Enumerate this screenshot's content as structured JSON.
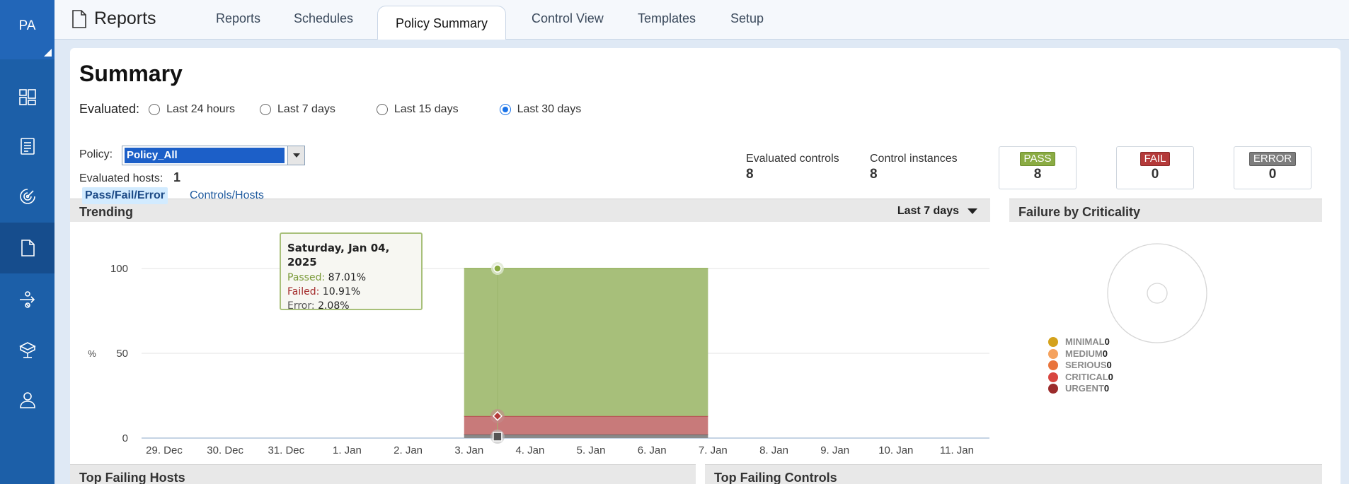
{
  "brand": "PA",
  "app_title": "Reports",
  "tabs": [
    {
      "label": "Reports"
    },
    {
      "label": "Schedules"
    },
    {
      "label": "Policy Summary"
    },
    {
      "label": "Control View"
    },
    {
      "label": "Templates"
    },
    {
      "label": "Setup"
    }
  ],
  "active_tab": "Policy Summary",
  "nav_icons": [
    "dashboard-icon",
    "document-list-icon",
    "radar-icon",
    "reports-icon",
    "workflow-icon",
    "package-icon",
    "user-icon"
  ],
  "summary": {
    "title": "Summary",
    "evaluated_label": "Evaluated:",
    "ranges": [
      {
        "label": "Last 24 hours",
        "checked": false
      },
      {
        "label": "Last 7 days",
        "checked": false
      },
      {
        "label": "Last 15 days",
        "checked": false
      },
      {
        "label": "Last 30 days",
        "checked": true
      }
    ],
    "policy_label": "Policy:",
    "policy_value": "Policy_All",
    "hosts_label": "Evaluated hosts:",
    "hosts_value": "1",
    "evaluated_controls_label": "Evaluated controls",
    "evaluated_controls_value": "8",
    "control_instances_label": "Control instances",
    "control_instances_value": "8",
    "pass": {
      "label": "PASS",
      "value": "8",
      "color": "#8aab43"
    },
    "fail": {
      "label": "FAIL",
      "value": "0",
      "color": "#b43a3a"
    },
    "error": {
      "label": "ERROR",
      "value": "0",
      "color": "#7d7d7d"
    }
  },
  "trending": {
    "title": "Trending",
    "range": "Last 7 days",
    "subtabs": [
      "Pass/Fail/Error",
      "Controls/Hosts"
    ]
  },
  "chart_data": {
    "type": "area",
    "ylabel": "%",
    "ylim": [
      0,
      100
    ],
    "yticks": [
      0,
      50,
      100
    ],
    "x": [
      "29. Dec",
      "30. Dec",
      "31. Dec",
      "1. Jan",
      "2. Jan",
      "3. Jan",
      "4. Jan",
      "5. Jan",
      "6. Jan",
      "7. Jan",
      "8. Jan",
      "9. Jan",
      "10. Jan",
      "11. Jan"
    ],
    "data_range": [
      "3. Jan",
      "7. Jan"
    ],
    "series": [
      {
        "name": "Passed",
        "color": "#a7bf7a",
        "value": 87.01
      },
      {
        "name": "Failed",
        "color": "#c87a7a",
        "value": 10.91
      },
      {
        "name": "Error",
        "color": "#8a8a8a",
        "value": 2.08
      }
    ],
    "tooltip": {
      "date": "Saturday, Jan 04, 2025",
      "passed_label": "Passed:",
      "passed": "87.01%",
      "failed_label": "Failed:",
      "failed": "10.91%",
      "error_label": "Error:",
      "error": "2.08%"
    }
  },
  "criticality": {
    "title": "Failure by Criticality",
    "items": [
      {
        "label": "MINIMAL",
        "count": "0",
        "color": "#d4a21c"
      },
      {
        "label": "MEDIUM",
        "count": "0",
        "color": "#f5a25e"
      },
      {
        "label": "SERIOUS",
        "count": "0",
        "color": "#e9743c"
      },
      {
        "label": "CRITICAL",
        "count": "0",
        "color": "#d8453f"
      },
      {
        "label": "URGENT",
        "count": "0",
        "color": "#9b2b2b"
      }
    ]
  },
  "bottom_panels": {
    "hosts": "Top Failing Hosts",
    "controls": "Top Failing Controls"
  }
}
